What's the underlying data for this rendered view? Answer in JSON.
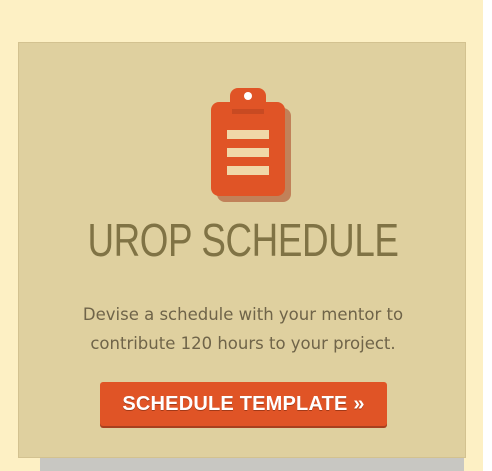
{
  "card": {
    "title": "UROP SCHEDULE",
    "description_line1": "Devise a schedule with your mentor to",
    "description_line2": "contribute 120 hours to your project.",
    "button_label": "SCHEDULE TEMPLATE »",
    "icon": "clipboard-icon"
  },
  "colors": {
    "page_background": "#fdf0c4",
    "card_background": "#dfd09f",
    "accent": "#e05426",
    "title": "#807345",
    "body_text": "#6f6449"
  }
}
